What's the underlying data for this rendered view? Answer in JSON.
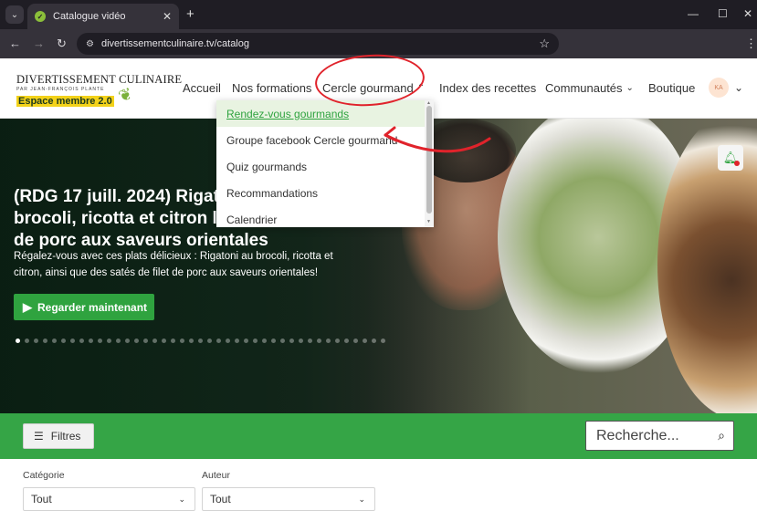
{
  "browser": {
    "tab_title": "Catalogue vidéo",
    "url": "divertissementculinaire.tv/catalog",
    "tab_close": "✕",
    "new_tab": "+",
    "minimize": "—",
    "maximize": "☐",
    "close": "✕"
  },
  "header": {
    "logo_line1": "DIVERTISSEMENT CULINAIRE",
    "logo_line2": "PAR JEAN-FRANÇOIS PLANTE",
    "logo_line3": "Espace membre 2.0",
    "nav": [
      "Accueil",
      "Nos formations",
      "Cercle gourmand",
      "Index des recettes",
      "Communautés",
      "Boutique"
    ],
    "avatar_initials": "KA"
  },
  "dropdown": {
    "items": [
      "Rendez-vous gourmands",
      "Groupe facebook Cercle gourmand",
      "Quiz gourmands",
      "Recommandations",
      "Calendrier"
    ],
    "highlighted_index": 0
  },
  "hero": {
    "title": "(RDG 17 juill. 2024) Rigatoni brocoli, ricotta et citron l Satés de porc aux saveurs orientales",
    "description": "Régalez-vous avec ces plats délicieux : Rigatoni au brocoli, ricotta et citron, ainsi que des satés de filet de porc aux saveurs orientales!",
    "button_label": "Regarder maintenant",
    "slide_count": 42,
    "active_slide": 0
  },
  "filter_bar": {
    "filters_label": "Filtres",
    "search_placeholder": "Recherche..."
  },
  "filters": {
    "category_label": "Catégorie",
    "category_value": "Tout",
    "author_label": "Auteur",
    "author_value": "Tout"
  },
  "colors": {
    "brand_green": "#35a546",
    "annotation_red": "#e0232b",
    "hero_button": "#2fa33f"
  }
}
